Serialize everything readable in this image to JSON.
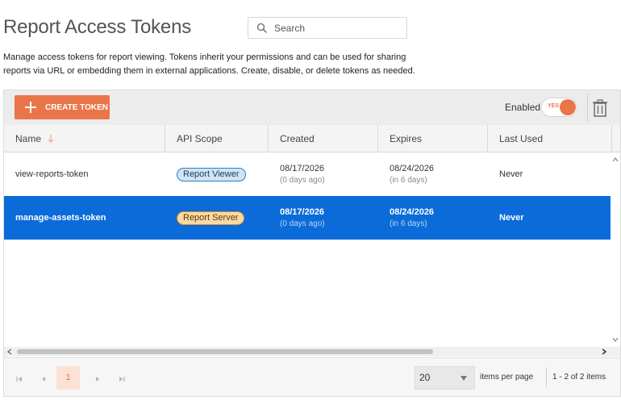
{
  "header": {
    "title": "Report Access Tokens",
    "search_placeholder": "Search"
  },
  "description": "Manage access tokens for report viewing. Tokens inherit your permissions and can be used for sharing reports via URL or embedding them in external applications. Create, disable, or delete tokens as needed.",
  "toolbar": {
    "create_label": "CREATE TOKEN",
    "enabled_label": "Enabled",
    "toggle_text": "YES",
    "toggle_on": true
  },
  "table": {
    "columns": [
      "Name",
      "API Scope",
      "Created",
      "Expires",
      "Last Used"
    ],
    "rows": [
      {
        "name": "view-reports-token",
        "scope": "Report Viewer",
        "created": "08/17/2026",
        "created_rel": "(0 days ago)",
        "expires": "08/24/2026",
        "expires_rel": "(in 6 days)",
        "last_used": "Never",
        "selected": false
      },
      {
        "name": "manage-assets-token",
        "scope": "Report Server",
        "created": "08/17/2026",
        "created_rel": "(0 days ago)",
        "expires": "08/24/2026",
        "expires_rel": "(in 6 days)",
        "last_used": "Never",
        "selected": true
      }
    ]
  },
  "pager": {
    "current_page": "1",
    "page_size": "20",
    "page_size_label": "items per page",
    "info": "1 - 2 of 2 items"
  },
  "colors": {
    "accent": "#e9764a",
    "selected_row": "#0b6bd9",
    "viewer_badge": "#cfe4f7",
    "server_badge": "#fbd9a3"
  }
}
